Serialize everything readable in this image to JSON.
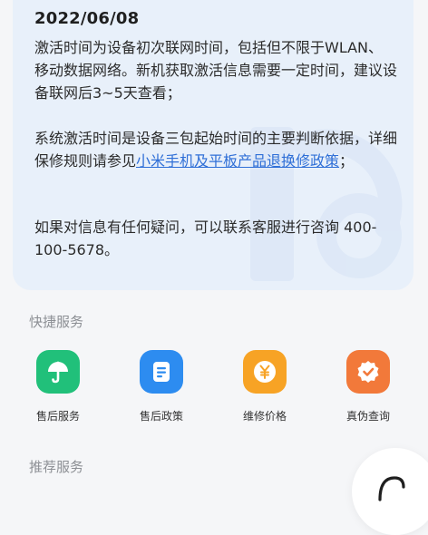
{
  "activation_card": {
    "date": "2022/06/08",
    "para1": "激活时间为设备初次联网时间，包括但不限于WLAN、移动数据网络。新机获取激活信息需要一定时间，建议设备联网后3~5天查看；",
    "para2_prefix": "系统激活时间是设备三包起始时间的主要判断依据，详细保修规则请参见",
    "para2_link": "小米手机及平板产品退换修政策",
    "para2_suffix": "；",
    "para3": "如果对信息有任何疑问，可以联系客服进行咨询 400-100-5678。"
  },
  "quick_services": {
    "title": "快捷服务",
    "items": [
      {
        "label": "售后服务",
        "icon": "umbrella-icon",
        "color": "#21c07a"
      },
      {
        "label": "售后政策",
        "icon": "document-icon",
        "color": "#2d8cf0"
      },
      {
        "label": "维修价格",
        "icon": "yen-coin-icon",
        "color": "#f7a325"
      },
      {
        "label": "真伪查询",
        "icon": "verify-badge-icon",
        "color": "#f2793a"
      }
    ]
  },
  "recommended_services": {
    "title": "推荐服务"
  }
}
